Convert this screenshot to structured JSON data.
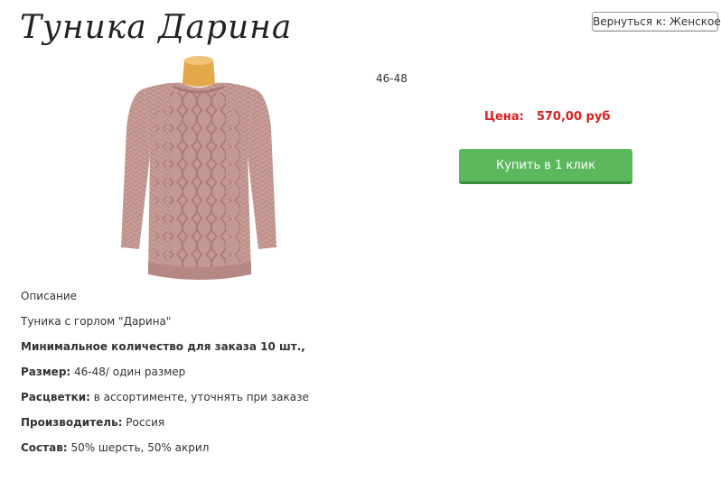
{
  "product": {
    "title": "Туника Дарина",
    "back_label": "Вернуться к: Женское",
    "size_top": "46-48",
    "price_label": "Цена:",
    "price_value": "570,00 руб",
    "buy_label": "Купить в 1 клик",
    "image_alt": "pink knitted tunic on mannequin"
  },
  "description": {
    "heading": "Описание",
    "intro": "Туника с горлом \"Дарина\"",
    "min_order": "Минимальное количество для заказа 10 шт.,",
    "size_label": "Размер:",
    "size_value": "46-48/ один размер",
    "colors_label": "Расцветки:",
    "colors_value": "в ассортименте, уточнять при заказе",
    "maker_label": "Производитель:",
    "maker_value": "Россия",
    "composition_label": "Состав:",
    "composition_value": "50% шерсть, 50% акрил"
  },
  "colors": {
    "price_red": "#e01e1e",
    "buy_green": "#5cb85c",
    "garment_pink": "#c79a96"
  }
}
